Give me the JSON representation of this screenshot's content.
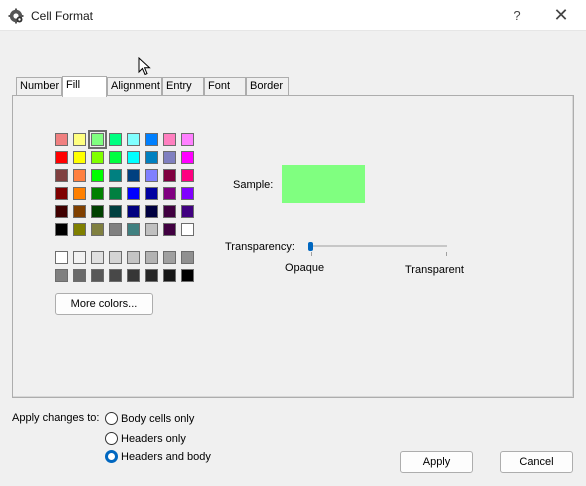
{
  "window": {
    "title": "Cell Format",
    "help_glyph": "?",
    "close_glyph": "✕"
  },
  "tabs": [
    {
      "label": "Number",
      "active": false
    },
    {
      "label": "Fill",
      "active": true
    },
    {
      "label": "Alignment",
      "active": false
    },
    {
      "label": "Entry",
      "active": false
    },
    {
      "label": "Font",
      "active": false
    },
    {
      "label": "Border",
      "active": false
    }
  ],
  "palette": {
    "rows": [
      [
        "#f08080",
        "#ffff80",
        "#80ff80",
        "#00ff80",
        "#80ffff",
        "#0080ff",
        "#ff80c0",
        "#ff80ff"
      ],
      [
        "#ff0000",
        "#ffff00",
        "#80ff00",
        "#00ff40",
        "#00ffff",
        "#0080c0",
        "#8080c0",
        "#ff00ff"
      ],
      [
        "#804040",
        "#ff8040",
        "#00ff00",
        "#008080",
        "#004080",
        "#8080ff",
        "#800040",
        "#ff0080"
      ],
      [
        "#800000",
        "#ff8000",
        "#008000",
        "#008040",
        "#0000ff",
        "#0000a0",
        "#800080",
        "#8000ff"
      ],
      [
        "#400000",
        "#804000",
        "#004000",
        "#004040",
        "#000080",
        "#000040",
        "#400040",
        "#400080"
      ],
      [
        "#000000",
        "#808000",
        "#808040",
        "#808080",
        "#408080",
        "#c0c0c0",
        "#400040",
        "#ffffff"
      ]
    ],
    "gray_rows": [
      [
        "#ffffff",
        "#f2f2f2",
        "#e0e0e0",
        "#d4d4d4",
        "#c4c4c4",
        "#b2b2b2",
        "#a0a0a0",
        "#909090"
      ],
      [
        "#808080",
        "#6a6a6a",
        "#585858",
        "#484848",
        "#363636",
        "#262626",
        "#161616",
        "#000000"
      ]
    ],
    "selected": "#80ff80"
  },
  "fill": {
    "more_colors_label": "More colors...",
    "sample_label": "Sample:",
    "sample_color": "#80ff80",
    "transparency_label": "Transparency:",
    "transparency_value": 0,
    "opaque_label": "Opaque",
    "transparent_label": "Transparent"
  },
  "apply_section": {
    "label": "Apply changes to:",
    "options": [
      {
        "label": "Body cells only",
        "checked": false
      },
      {
        "label": "Headers only",
        "checked": false
      },
      {
        "label": "Headers and body",
        "checked": true
      }
    ]
  },
  "buttons": {
    "apply": "Apply",
    "cancel": "Cancel"
  },
  "colors": {
    "accent": "#0067c0",
    "window_bg": "#f0f0f0",
    "title_bg": "#ffffff"
  }
}
